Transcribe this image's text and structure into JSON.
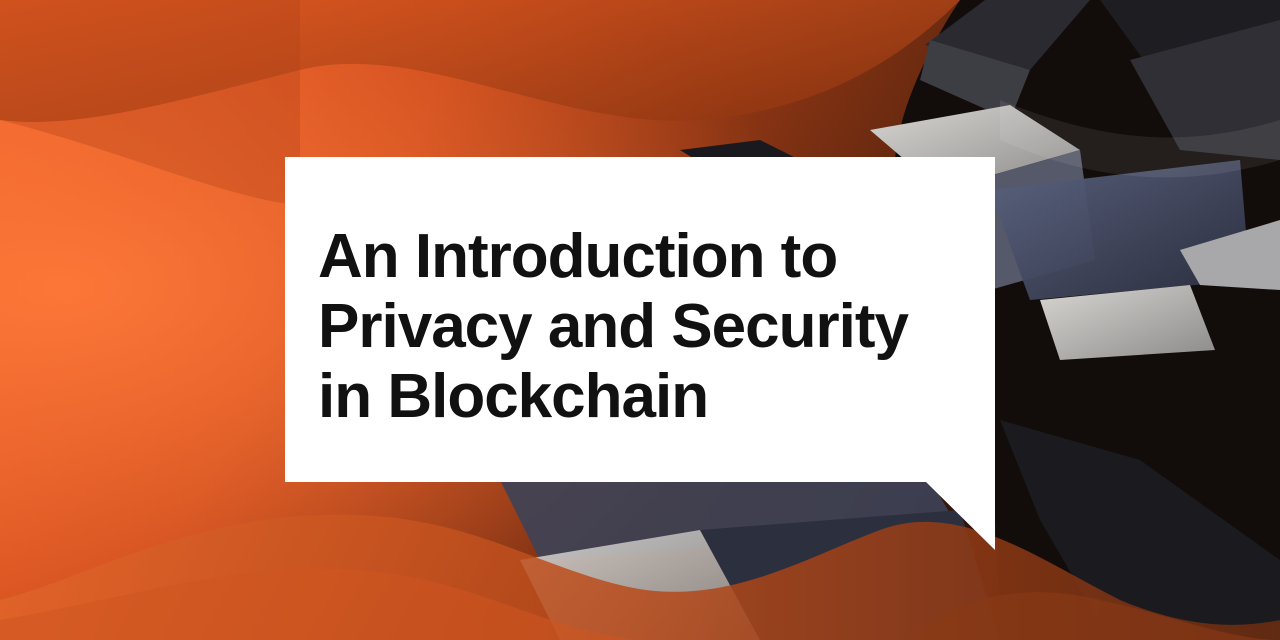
{
  "headline": {
    "lines": [
      "An Introduction to",
      "Privacy and Security",
      "in Blockchain"
    ]
  },
  "colors": {
    "accent_orange": "#e8531f",
    "deep_orange": "#a63a12",
    "dark_brown": "#3a1a0c",
    "cube_dark": "#141417",
    "cube_slate": "#4a5068",
    "cube_light": "#c9c7c4",
    "bubble": "#ffffff",
    "text": "#111111"
  }
}
